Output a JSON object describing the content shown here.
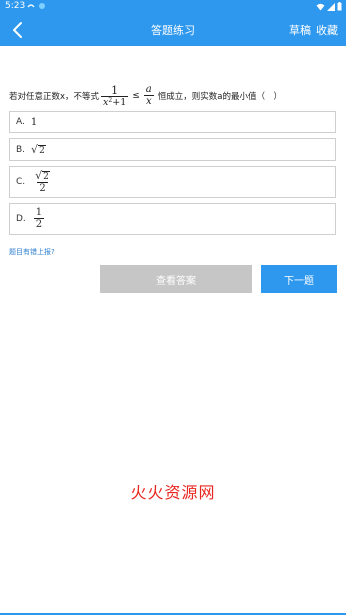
{
  "status_bar": {
    "time": "5:23"
  },
  "app_bar": {
    "title": "答题练习",
    "draft_label": "草稿",
    "favorite_label": "收藏"
  },
  "question": {
    "prefix": "若对任意正数x，不等式",
    "frac1": {
      "num": "1",
      "den_base": "x",
      "den_exp": "2",
      "den_rest": "+1"
    },
    "relation": "≤",
    "frac2": {
      "num": "a",
      "den": "x"
    },
    "suffix": "恒成立，则实数a的最小值（　）"
  },
  "options": [
    {
      "letter": "A.",
      "value": "1"
    },
    {
      "letter": "B.",
      "radicand": "2"
    },
    {
      "letter": "C.",
      "radicand": "2",
      "den": "2"
    },
    {
      "letter": "D.",
      "num": "1",
      "den": "2"
    }
  ],
  "report_error_link": "题目有错上报?",
  "buttons": {
    "view_answer": "查看答案",
    "next": "下一题"
  },
  "watermark": "火火资源网",
  "colors": {
    "primary": "#2e98ef",
    "disabled": "#c6c6c6",
    "watermark": "#e8261f"
  }
}
